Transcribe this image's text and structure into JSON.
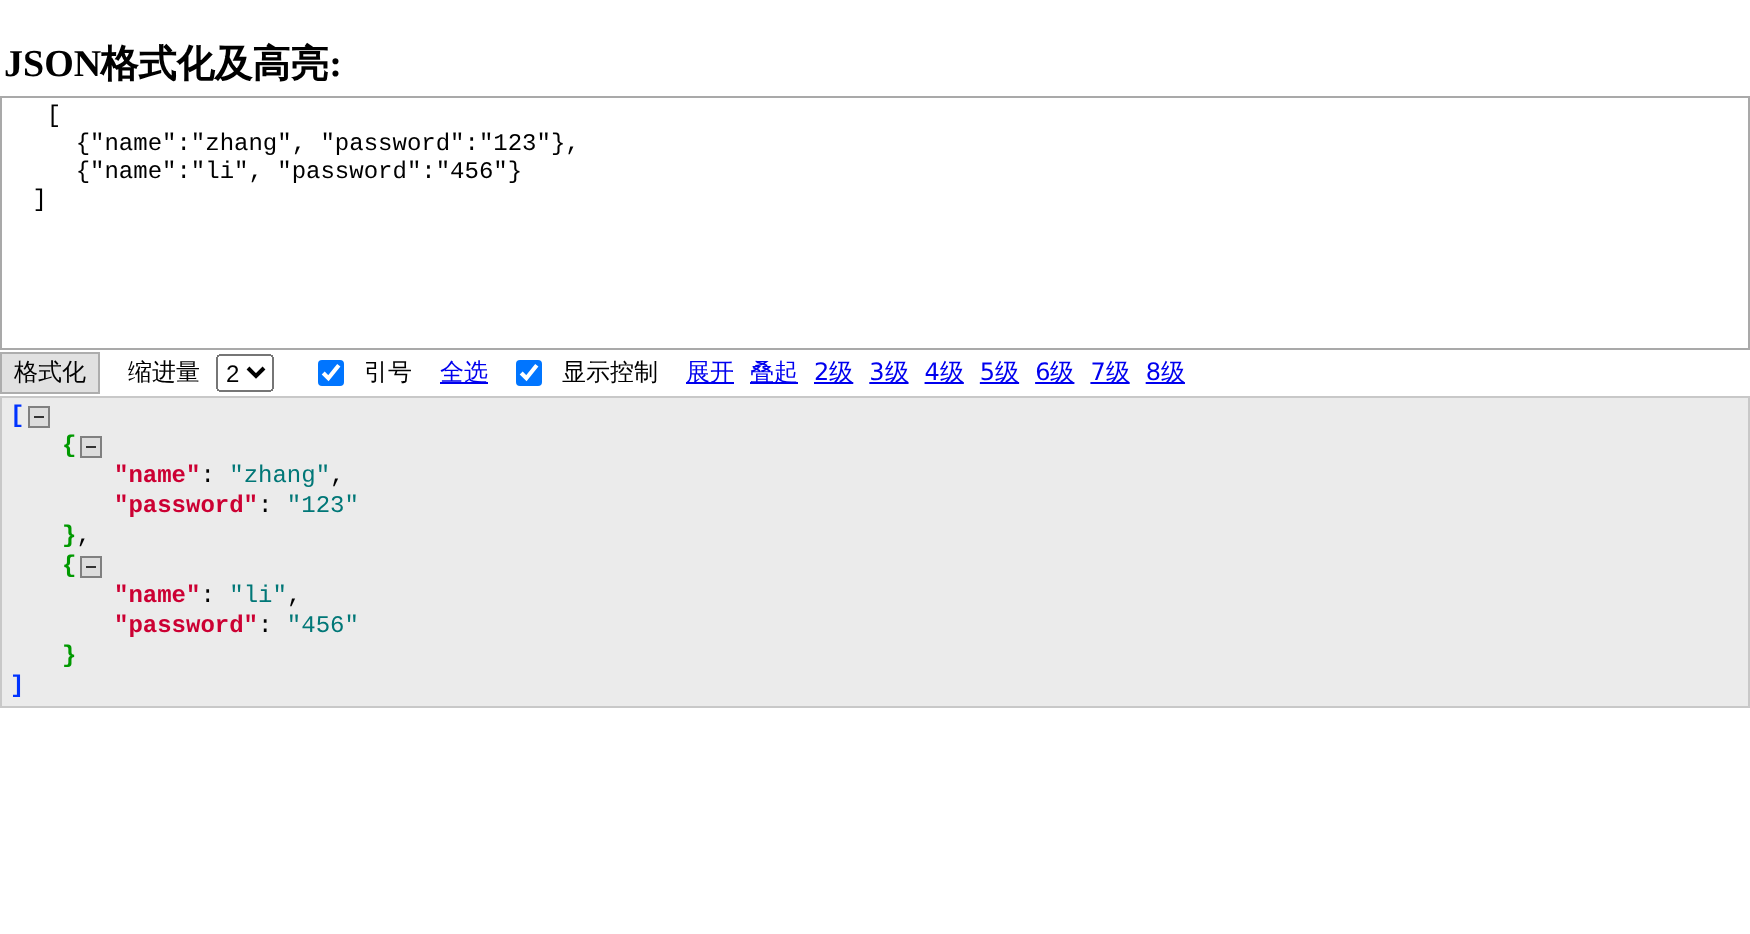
{
  "heading": "JSON格式化及高亮:",
  "input": {
    "value": "  [\n    {\"name\":\"zhang\", \"password\":\"123\"},\n    {\"name\":\"li\", \"password\":\"456\"}\n ]"
  },
  "toolbar": {
    "format_button": "格式化",
    "indent_label": "缩进量",
    "indent_value": "2",
    "quotes": {
      "label": "引号",
      "checked": true
    },
    "select_all": "全选",
    "show_controls": {
      "label": "显示控制",
      "checked": true
    },
    "links": [
      "展开",
      "叠起",
      "2级",
      "3级",
      "4级",
      "5级",
      "6级",
      "7级",
      "8级"
    ]
  },
  "output": {
    "open": "[",
    "close": "]",
    "expanded": true,
    "children": [
      {
        "open": "{",
        "close": "}",
        "comma": ",",
        "expanded": true,
        "entries": [
          {
            "key": "\"name\"",
            "colon": ":",
            "value": "\"zhang\"",
            "comma": ","
          },
          {
            "key": "\"password\"",
            "colon": ":",
            "value": "\"123\""
          }
        ]
      },
      {
        "open": "{",
        "close": "}",
        "expanded": true,
        "entries": [
          {
            "key": "\"name\"",
            "colon": ":",
            "value": "\"li\"",
            "comma": ","
          },
          {
            "key": "\"password\"",
            "colon": ":",
            "value": "\"456\""
          }
        ]
      }
    ]
  }
}
